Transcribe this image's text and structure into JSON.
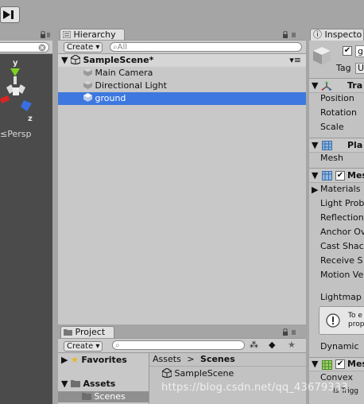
{
  "toolbar": {
    "step_icon": "step-icon"
  },
  "scene": {
    "persp_label": "Persp",
    "persp_prefix": "≤",
    "gizmo": {
      "y": "y",
      "z": "z"
    }
  },
  "hierarchy": {
    "tab_label": "Hierarchy",
    "create_label": "Create",
    "search_placeholder": "All",
    "scene_name": "SampleScene*",
    "items": [
      {
        "label": "Main Camera"
      },
      {
        "label": "Directional Light"
      },
      {
        "label": "ground"
      }
    ]
  },
  "project": {
    "tab_label": "Project",
    "create_label": "Create",
    "favorites_label": "Favorites",
    "assets_label": "Assets",
    "scenes_folder_label": "Scenes",
    "breadcrumb": {
      "root": "Assets",
      "sep": ">",
      "current": "Scenes"
    },
    "files": [
      {
        "label": "SampleScene"
      }
    ]
  },
  "inspector": {
    "tab_label": "Inspecto",
    "name_value": "g",
    "tag_label": "Tag",
    "tag_value": "U",
    "transform": {
      "title": "Tra",
      "rows": [
        "Position",
        "Rotation",
        "Scale"
      ]
    },
    "mesh_filter": {
      "title": "Pla",
      "rows": [
        "Mesh"
      ]
    },
    "mesh_renderer": {
      "title": "Mes",
      "rows": [
        "Materials",
        "Light Prob",
        "Reflection",
        "Anchor Ov",
        "Cast Shac",
        "Receive S",
        "Motion Ve"
      ],
      "lightmap_label": "Lightmap",
      "info_text_1": "To e",
      "info_text_2": "prop",
      "dynamic_label": "Dynamic"
    },
    "mesh_collider": {
      "title": "Mes",
      "rows": [
        "Convex"
      ],
      "trigger_label": "Is Trigg"
    }
  },
  "watermark": "https://blog.csdn.net/qq_43679333",
  "colors": {
    "selection": "#3c78e0",
    "scene_bg": "#4b4b4b",
    "panel_bg": "#c2c2c2"
  }
}
